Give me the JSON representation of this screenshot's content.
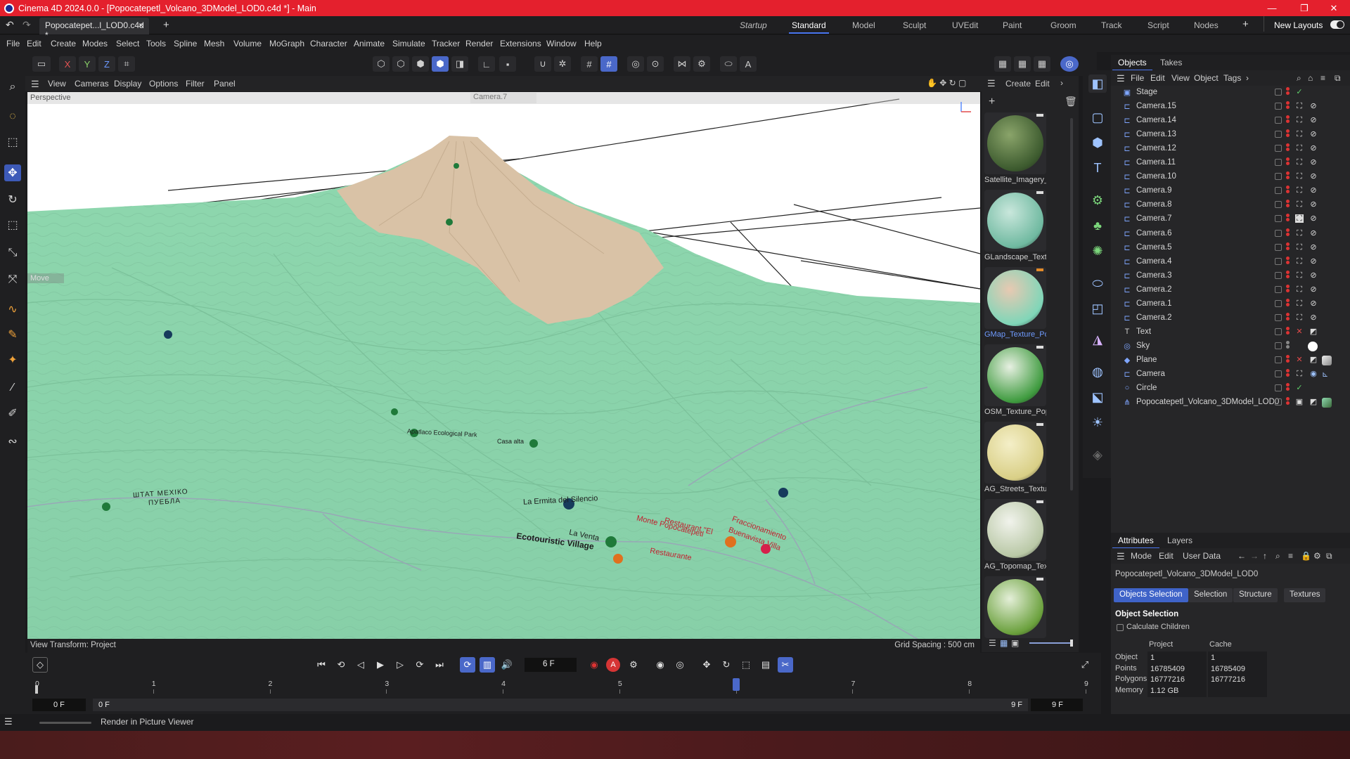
{
  "window": {
    "title": "Cinema 4D 2024.0.0 - [Popocatepetl_Volcano_3DModel_LOD0.c4d *] - Main",
    "minimize": "—",
    "maximize": "❐",
    "close": "✕"
  },
  "doc_tab": {
    "label": "Popocatepet...l_LOD0.c4d *",
    "close": "×",
    "add": "+"
  },
  "layouts": {
    "items": [
      "Startup",
      "Standard",
      "Model",
      "Sculpt",
      "UVEdit",
      "Paint",
      "Groom",
      "Track",
      "Script",
      "Nodes"
    ],
    "selected": "Standard",
    "add": "+",
    "new_layouts": "New Layouts"
  },
  "menu": [
    "File",
    "Edit",
    "Create",
    "Modes",
    "Select",
    "Tools",
    "Spline",
    "Mesh",
    "Volume",
    "MoGraph",
    "Character",
    "Animate",
    "Simulate",
    "Tracker",
    "Render",
    "Extensions",
    "Window",
    "Help"
  ],
  "axis_buttons": [
    "X",
    "Y",
    "Z"
  ],
  "viewport_menu": [
    "View",
    "Cameras",
    "Display",
    "Options",
    "Filter",
    "Panel"
  ],
  "viewport": {
    "mode_label": "Perspective",
    "camera_label": "Camera.7",
    "move_label": "Move",
    "view_transform": "View Transform: Project",
    "grid_spacing": "Grid Spacing : 500 cm",
    "map_labels": [
      "La Ermita del Silencio",
      "La Venta",
      "Ecotouristic Village",
      "Monte Popocatepetl",
      "Restaurant \"El",
      "Fraccionamiento",
      "Buenavista Villa",
      "Restaurante",
      "Apatlaco Ecological Park",
      "Casa alta",
      "ШТАТ МЕХІКО",
      "ПУЕБЛА"
    ],
    "colors": {
      "terrain": "#8fd9b0",
      "peak": "#d8c2a6",
      "sky": "#ffffff"
    }
  },
  "material_panel": {
    "menu": [
      "Create",
      "Edit"
    ],
    "materials": [
      {
        "label": "Satellite_Imagery_",
        "selected": false,
        "color_a": "#3c5a2e",
        "color_b": "#8aa46a"
      },
      {
        "label": "GLandscape_Textu",
        "selected": false,
        "color_a": "#6fb9a0",
        "color_b": "#c9e7dc"
      },
      {
        "label": "GMap_Texture_Po",
        "selected": true,
        "color_a": "#7fd6b8",
        "color_b": "#e8c9b2"
      },
      {
        "label": "OSM_Texture_Pop",
        "selected": false,
        "color_a": "#3f9b3f",
        "color_b": "#e7f0e2"
      },
      {
        "label": "AG_Streets_Textur",
        "selected": false,
        "color_a": "#d9cf86",
        "color_b": "#f4efc8"
      },
      {
        "label": "AG_Topomap_Tex",
        "selected": false,
        "color_a": "#b9c8a6",
        "color_b": "#f1f3ec"
      },
      {
        "label": "",
        "selected": false,
        "color_a": "#6aa03c",
        "color_b": "#e4efd8"
      }
    ]
  },
  "objects_panel": {
    "tabs": [
      "Objects",
      "Takes"
    ],
    "selected_tab": "Objects",
    "menu": [
      "File",
      "Edit",
      "View",
      "Object",
      "Tags"
    ],
    "objects": [
      {
        "name": "Stage",
        "icon": "▣",
        "tag": "check"
      },
      {
        "name": "Camera.15",
        "icon": "⊏",
        "tag": "cam"
      },
      {
        "name": "Camera.14",
        "icon": "⊏",
        "tag": "cam"
      },
      {
        "name": "Camera.13",
        "icon": "⊏",
        "tag": "cam"
      },
      {
        "name": "Camera.12",
        "icon": "⊏",
        "tag": "cam"
      },
      {
        "name": "Camera.11",
        "icon": "⊏",
        "tag": "cam"
      },
      {
        "name": "Camera.10",
        "icon": "⊏",
        "tag": "cam"
      },
      {
        "name": "Camera.9",
        "icon": "⊏",
        "tag": "cam"
      },
      {
        "name": "Camera.8",
        "icon": "⊏",
        "tag": "cam"
      },
      {
        "name": "Camera.7",
        "icon": "⊏",
        "tag": "cam-active"
      },
      {
        "name": "Camera.6",
        "icon": "⊏",
        "tag": "cam"
      },
      {
        "name": "Camera.5",
        "icon": "⊏",
        "tag": "cam"
      },
      {
        "name": "Camera.4",
        "icon": "⊏",
        "tag": "cam"
      },
      {
        "name": "Camera.3",
        "icon": "⊏",
        "tag": "cam"
      },
      {
        "name": "Camera.2",
        "icon": "⊏",
        "tag": "cam"
      },
      {
        "name": "Camera.1",
        "icon": "⊏",
        "tag": "cam"
      },
      {
        "name": "Camera.2",
        "icon": "⊏",
        "tag": "cam"
      },
      {
        "name": "Text",
        "icon": "T",
        "tag": "text"
      },
      {
        "name": "Sky",
        "icon": "◎",
        "tag": "sky"
      },
      {
        "name": "Plane",
        "icon": "◆",
        "tag": "plane"
      },
      {
        "name": "Camera",
        "icon": "⊏",
        "tag": "camera-plain"
      },
      {
        "name": "Circle",
        "icon": "○",
        "tag": "check"
      },
      {
        "name": "Popocatepetl_Volcano_3DModel_LOD0",
        "icon": "⋔",
        "tag": "model"
      }
    ]
  },
  "attributes_panel": {
    "tabs": [
      "Attributes",
      "Layers"
    ],
    "selected_tab": "Attributes",
    "menu": [
      "Mode",
      "Edit",
      "User Data"
    ],
    "object_name": "Popocatepetl_Volcano_3DModel_LOD0",
    "buttons": [
      "Objects Selection",
      "Selection",
      "Structure",
      "Textures"
    ],
    "selected_button": "Objects Selection",
    "section": "Object Selection",
    "calculate_children": "Calculate Children",
    "columns": [
      "Project",
      "Cache"
    ],
    "rows": [
      {
        "label": "Object",
        "project": "1",
        "cache": "1"
      },
      {
        "label": "Points",
        "project": "16785409",
        "cache": "16785409"
      },
      {
        "label": "Polygons",
        "project": "16777216",
        "cache": "16777216"
      },
      {
        "label": "Memory",
        "project": "1.12 GB",
        "cache": ""
      }
    ]
  },
  "timeline": {
    "current_frame": "6 F",
    "ruler": [
      "0",
      "1",
      "2",
      "3",
      "4",
      "5",
      "6",
      "7",
      "8",
      "9"
    ],
    "start_field": "0 F",
    "start_field2": "0 F",
    "end_field": "9 F",
    "end_field2": "9 F",
    "playhead_frame": 6,
    "frame_count": 9
  },
  "status": {
    "text": "Render in Picture Viewer"
  }
}
